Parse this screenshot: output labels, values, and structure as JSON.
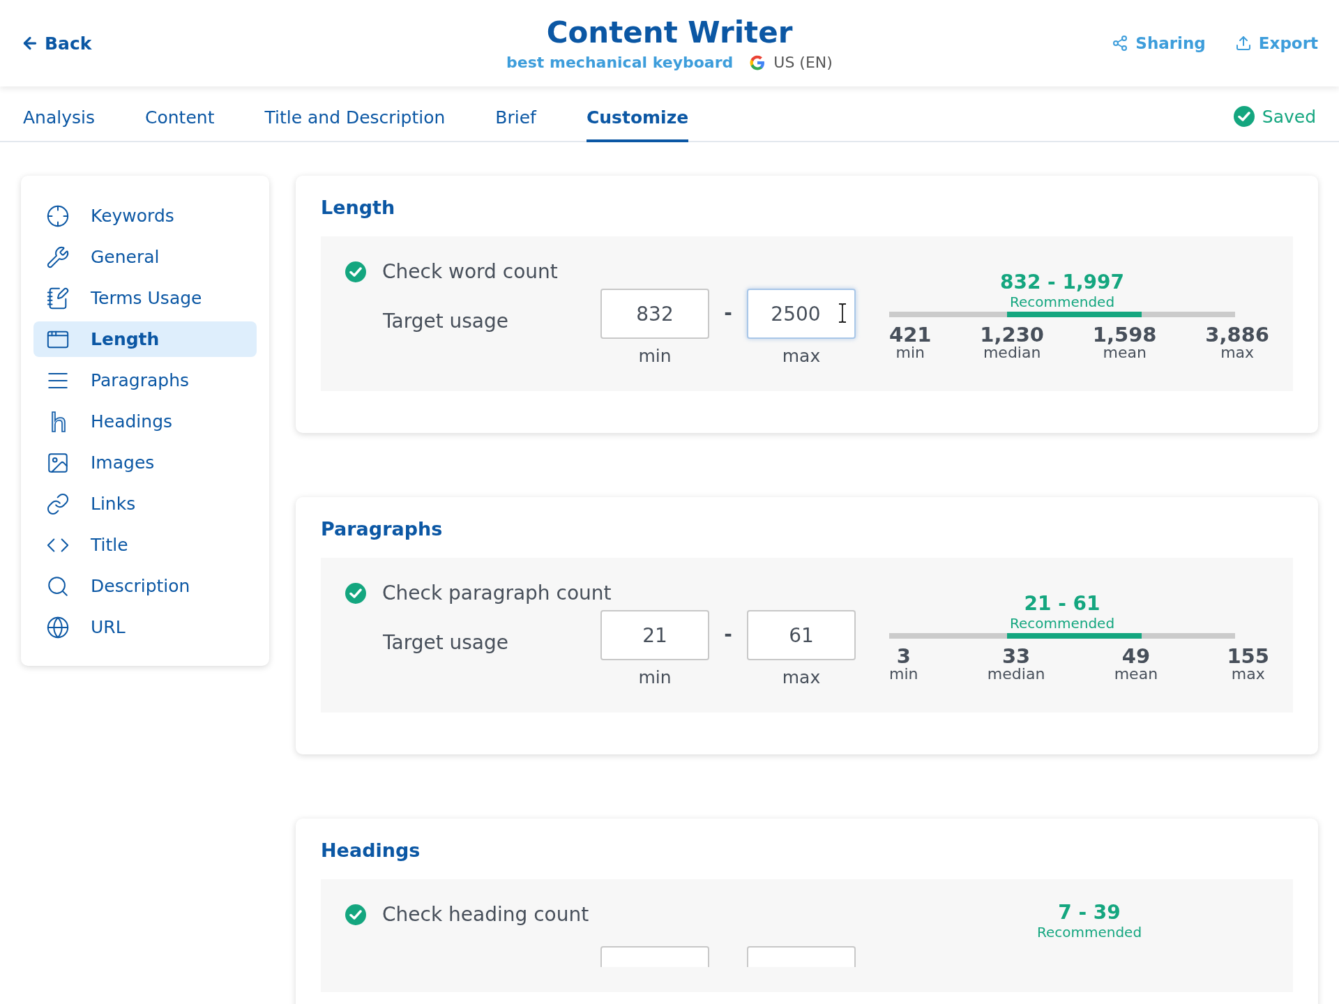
{
  "header": {
    "back": "Back",
    "title": "Content Writer",
    "keyword": "best mechanical keyboard",
    "locale": "US (EN)",
    "actions": [
      "Sharing",
      "Export"
    ]
  },
  "tabs": [
    {
      "label": "Analysis",
      "selected": false
    },
    {
      "label": "Content",
      "selected": false
    },
    {
      "label": "Title and Description",
      "selected": false
    },
    {
      "label": "Brief",
      "selected": false
    },
    {
      "label": "Customize",
      "selected": true
    }
  ],
  "save_status": "Saved",
  "sidebar": {
    "items": [
      {
        "label": "Keywords",
        "selected": false
      },
      {
        "label": "General",
        "selected": false
      },
      {
        "label": "Terms Usage",
        "selected": false
      },
      {
        "label": "Length",
        "selected": true
      },
      {
        "label": "Paragraphs",
        "selected": false
      },
      {
        "label": "Headings",
        "selected": false
      },
      {
        "label": "Images",
        "selected": false
      },
      {
        "label": "Links",
        "selected": false
      },
      {
        "label": "Title",
        "selected": false
      },
      {
        "label": "Description",
        "selected": false
      },
      {
        "label": "URL",
        "selected": false
      }
    ]
  },
  "sections": [
    {
      "title": "Length",
      "check_label": "Check word count",
      "checked": true,
      "target_label": "Target usage",
      "min": {
        "value": "832",
        "caption": "min",
        "focused": false
      },
      "separator": "-",
      "max": {
        "value": "2500",
        "caption": "max",
        "focused": true
      },
      "recommended": "832 - 1,997",
      "recommended_caption": "Recommended",
      "bar": {
        "start": {
          "level": 0.34
        },
        "end": {
          "level": 0.73
        }
      },
      "stats": [
        {
          "value": "421",
          "caption": "min"
        },
        {
          "value": "1,230",
          "caption": "median"
        },
        {
          "value": "1,598",
          "caption": "mean"
        },
        {
          "value": "3,886",
          "caption": "max"
        }
      ]
    },
    {
      "title": "Paragraphs",
      "check_label": "Check paragraph count",
      "checked": true,
      "target_label": "Target usage",
      "min": {
        "value": "21",
        "caption": "min",
        "focused": false
      },
      "separator": "-",
      "max": {
        "value": "61",
        "caption": "max",
        "focused": false
      },
      "recommended": "21 - 61",
      "recommended_caption": "Recommended",
      "bar": {
        "start": {
          "level": 0.34
        },
        "end": {
          "level": 0.73
        }
      },
      "stats": [
        {
          "value": "3",
          "caption": "min"
        },
        {
          "value": "33",
          "caption": "median"
        },
        {
          "value": "49",
          "caption": "mean"
        },
        {
          "value": "155",
          "caption": "max"
        }
      ]
    },
    {
      "title": "Headings",
      "check_label": "Check heading count",
      "checked": true,
      "recommended": "7 - 39",
      "recommended_caption": "Recommended"
    }
  ]
}
